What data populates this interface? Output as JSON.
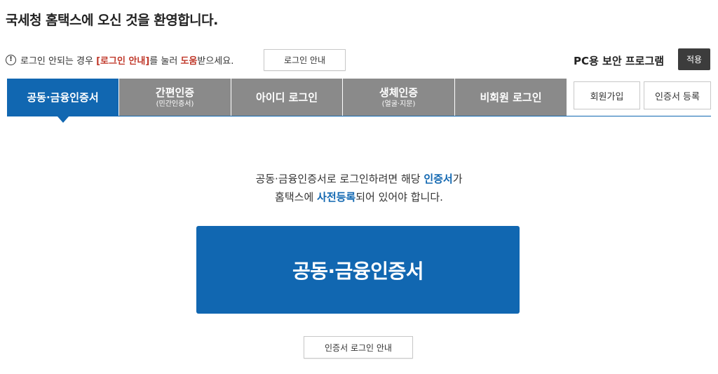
{
  "header": {
    "title": "국세청 홈택스에 오신 것을 환영합니다."
  },
  "notice": {
    "icon": "info-icon",
    "text_before": "로그인 안되는 경우 ",
    "text_highlight": "[로그인 안내]",
    "text_middle": "를 눌러 ",
    "text_highlight2": "도움",
    "text_after": "받으세요.",
    "button_label": "로그인 안내"
  },
  "security": {
    "label": "PC용 보안 프로그램",
    "apply_label": "적용"
  },
  "tabs": [
    {
      "main": "공동·금융인증서",
      "sub": "",
      "active": true
    },
    {
      "main": "간편인증",
      "sub": "(민간인증서)",
      "active": false
    },
    {
      "main": "아이디 로그인",
      "sub": "",
      "active": false
    },
    {
      "main": "생체인증",
      "sub": "(얼굴·지문)",
      "active": false
    },
    {
      "main": "비회원 로그인",
      "sub": "",
      "active": false
    }
  ],
  "side_buttons": {
    "signup": "회원가입",
    "cert_register": "인증서 등록"
  },
  "guide": {
    "line1_before": "공동·금융인증서로 로그인하려면 해당 ",
    "line1_highlight": "인증서",
    "line1_after": "가",
    "line2_before": "홈택스에 ",
    "line2_highlight": "사전등록",
    "line2_after": "되어 있어야 합니다."
  },
  "main_button": {
    "label": "공동·금융인증서"
  },
  "cert_guide_button": {
    "label": "인증서 로그인 안내"
  },
  "colors": {
    "accent": "#1167b1",
    "tab_inactive": "#8a8a8a",
    "notice_red": "#c0392b",
    "apply_bg": "#3c3c3c"
  }
}
